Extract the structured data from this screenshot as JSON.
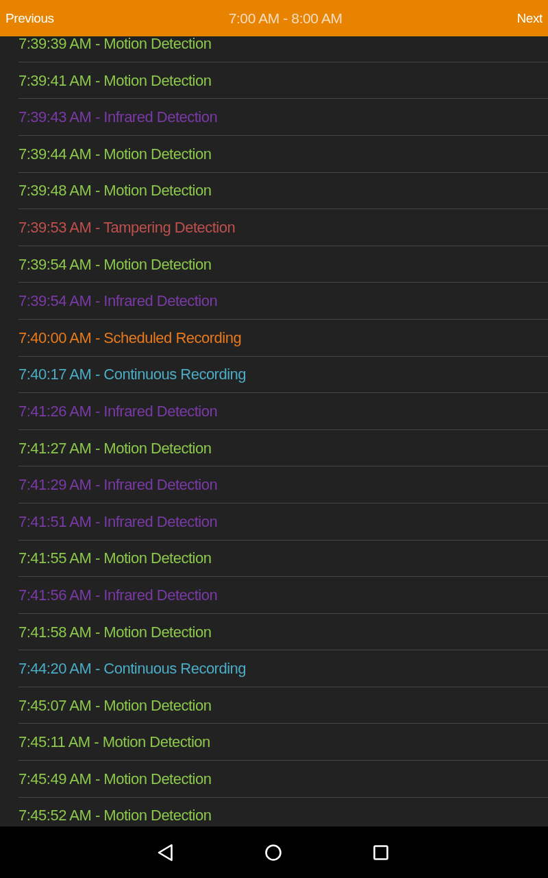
{
  "header": {
    "previous_label": "Previous",
    "title": "7:00 AM - 8:00 AM",
    "next_label": "Next"
  },
  "events": [
    {
      "label": "7:39:39 AM - Motion Detection",
      "color": "#8cc84b"
    },
    {
      "label": "7:39:41 AM - Motion Detection",
      "color": "#8cc84b"
    },
    {
      "label": "7:39:43 AM - Infrared Detection",
      "color": "#7b3aa8"
    },
    {
      "label": "7:39:44 AM - Motion Detection",
      "color": "#8cc84b"
    },
    {
      "label": "7:39:48 AM - Motion Detection",
      "color": "#8cc84b"
    },
    {
      "label": "7:39:53 AM - Tampering Detection",
      "color": "#c0504d"
    },
    {
      "label": "7:39:54 AM - Motion Detection",
      "color": "#8cc84b"
    },
    {
      "label": "7:39:54 AM - Infrared Detection",
      "color": "#7b3aa8"
    },
    {
      "label": "7:40:00 AM - Scheduled Recording",
      "color": "#e87a1c"
    },
    {
      "label": "7:40:17 AM - Continuous Recording",
      "color": "#4bacc6"
    },
    {
      "label": "7:41:26 AM - Infrared Detection",
      "color": "#7b3aa8"
    },
    {
      "label": "7:41:27 AM - Motion Detection",
      "color": "#8cc84b"
    },
    {
      "label": "7:41:29 AM - Infrared Detection",
      "color": "#7b3aa8"
    },
    {
      "label": "7:41:51 AM - Infrared Detection",
      "color": "#7b3aa8"
    },
    {
      "label": "7:41:55 AM - Motion Detection",
      "color": "#8cc84b"
    },
    {
      "label": "7:41:56 AM - Infrared Detection",
      "color": "#7b3aa8"
    },
    {
      "label": "7:41:58 AM - Motion Detection",
      "color": "#8cc84b"
    },
    {
      "label": "7:44:20 AM - Continuous Recording",
      "color": "#4bacc6"
    },
    {
      "label": "7:45:07 AM - Motion Detection",
      "color": "#8cc84b"
    },
    {
      "label": "7:45:11 AM - Motion Detection",
      "color": "#8cc84b"
    },
    {
      "label": "7:45:49 AM - Motion Detection",
      "color": "#8cc84b"
    },
    {
      "label": "7:45:52 AM - Motion Detection",
      "color": "#8cc84b"
    }
  ]
}
